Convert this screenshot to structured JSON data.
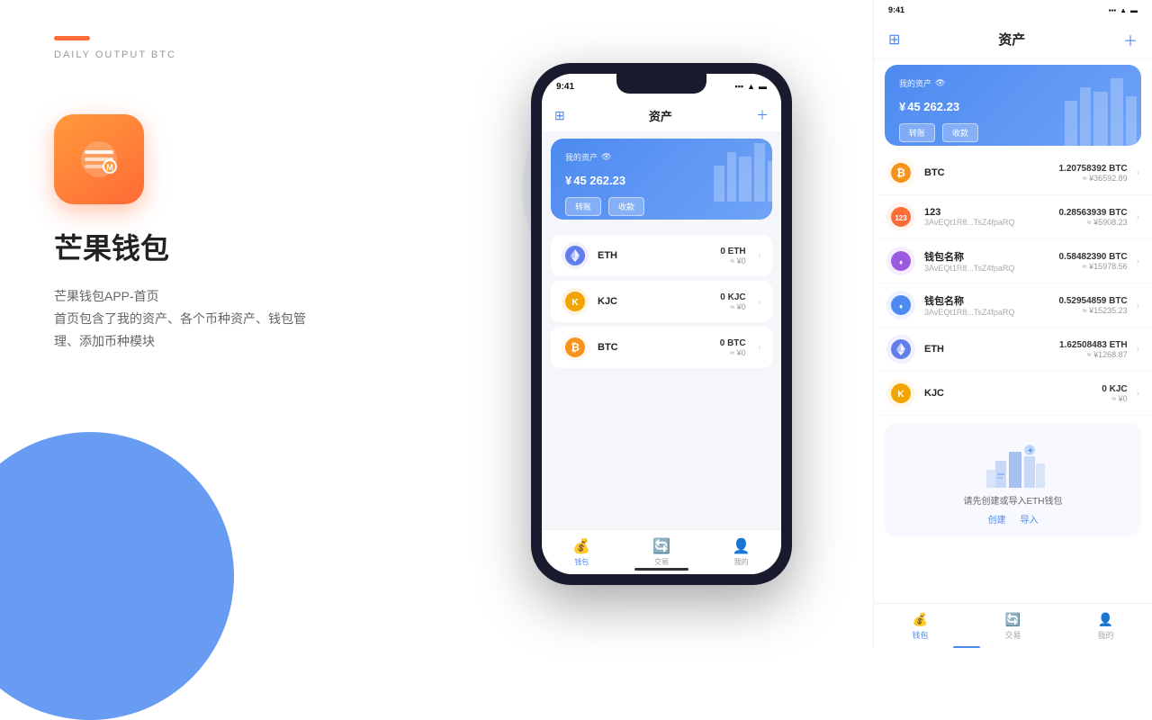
{
  "brand": {
    "line_color": "#ff6b35",
    "name": "芒果钱包",
    "subtitle": "DAILY OUTPUT BTC",
    "app_name": "芒果钱包",
    "desc_line1": "芒果钱包APP-首页",
    "desc_line2": "首页包含了我的资产、各个币种资产、钱包管",
    "desc_line3": "理、添加币种模块"
  },
  "phone": {
    "time": "9:41",
    "header_title": "资产",
    "asset": {
      "label": "我的资产",
      "currency": "¥",
      "amount": "45 262.23",
      "btn_transfer": "转账",
      "btn_receive": "收款"
    },
    "coins": [
      {
        "name": "ETH",
        "icon": "eth",
        "amount": "0 ETH",
        "value": "≈ ¥0",
        "symbol": "🔷"
      },
      {
        "name": "KJC",
        "icon": "kjc",
        "amount": "0 KJC",
        "value": "≈ ¥0",
        "symbol": "🟡"
      },
      {
        "name": "BTC",
        "icon": "btc",
        "amount": "0 BTC",
        "value": "≈ ¥0",
        "symbol": "₿"
      }
    ],
    "nav": [
      {
        "label": "钱包",
        "active": true
      },
      {
        "label": "交易",
        "active": false
      },
      {
        "label": "我的",
        "active": false
      }
    ]
  },
  "right_panel": {
    "time": "9:41",
    "header_title": "资产",
    "asset": {
      "label": "我的资产",
      "currency": "¥",
      "amount": "45 262.23",
      "btn_transfer": "转账",
      "btn_receive": "收款"
    },
    "coins": [
      {
        "name": "BTC",
        "addr": "",
        "amount": "1.20758392 BTC",
        "value": "≈ ¥36592.89",
        "icon": "btc",
        "color": "#f7931a"
      },
      {
        "name": "123",
        "addr": "3AvEQt1R8...TsZ4fpaRQ",
        "amount": "0.28563939 BTC",
        "value": "≈ ¥5908.23",
        "icon": "custom1",
        "color": "#ff6b35"
      },
      {
        "name": "钱包名称",
        "addr": "3AvEQt1R8...TsZ4fpaRQ",
        "amount": "0.58482390 BTC",
        "value": "≈ ¥15978.56",
        "icon": "custom2",
        "color": "#9c5bde"
      },
      {
        "name": "钱包名称",
        "addr": "3AvEQt1R8...TsZ4fpaRQ",
        "amount": "0.52954859 BTC",
        "value": "≈ ¥15235.23",
        "icon": "custom3",
        "color": "#4d8af0"
      },
      {
        "name": "ETH",
        "addr": "",
        "amount": "1.62508483 ETH",
        "value": "≈ ¥1268.87",
        "icon": "eth",
        "color": "#627eea"
      },
      {
        "name": "KJC",
        "addr": "",
        "amount": "0 KJC",
        "value": "≈ ¥0",
        "icon": "kjc",
        "color": "#f0a500"
      }
    ],
    "eth_prompt": {
      "text": "请先创建或导入ETH钱包",
      "create": "创建",
      "import": "导入"
    },
    "nav": [
      {
        "label": "钱包",
        "active": true
      },
      {
        "label": "交易",
        "active": false
      },
      {
        "label": "我的",
        "active": false
      }
    ]
  }
}
